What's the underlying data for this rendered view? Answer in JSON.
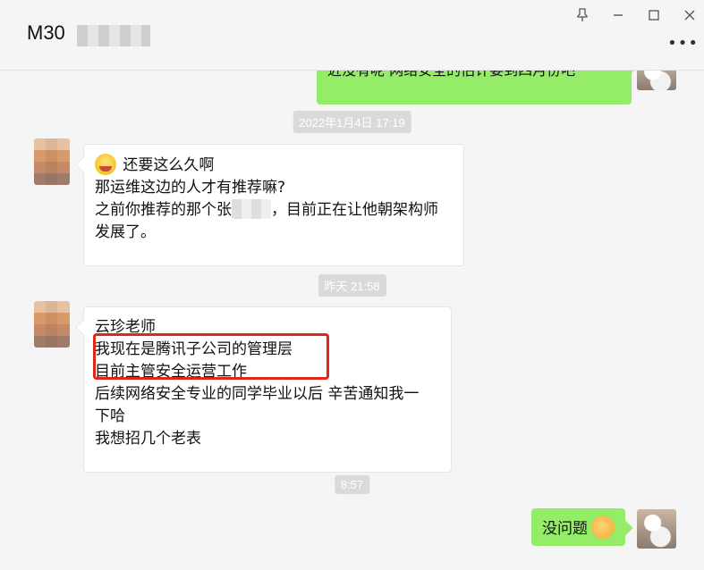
{
  "header": {
    "title": "M30",
    "icons": {
      "pin": "pin-icon",
      "minimize": "minimize-icon",
      "maximize": "maximize-icon",
      "close": "close-icon",
      "more": "more-icon"
    }
  },
  "chat": {
    "top_partial_message": "近没有呢  网络安全的估计要到四月份吧",
    "timestamps": [
      "2022年1月4日 17:19",
      "昨天 21:58",
      "8:57"
    ],
    "messages": [
      {
        "from": "peer",
        "lines": [
          "还要这么久啊",
          "那运维这边的人才有推荐嘛?",
          "之前你推荐的那个张",
          "，目前正在让他朝架构师",
          "发展了。"
        ],
        "icon": "crying-face-emoji-icon"
      },
      {
        "from": "peer",
        "lines": [
          "云珍老师",
          "我现在是腾讯子公司的管理层",
          "目前主管安全运营工作",
          "后续网络安全专业的同学毕业以后 辛苦通知我一",
          "下哈",
          "我想招几个老表"
        ]
      },
      {
        "from": "me",
        "text": "没问题",
        "icon": "ok-hand-emoji-icon"
      }
    ]
  },
  "colors": {
    "background": "#f5f5f5",
    "my_bubble": "#95ec69",
    "peer_bubble": "#ffffff",
    "highlight_box": "#e1261c"
  }
}
